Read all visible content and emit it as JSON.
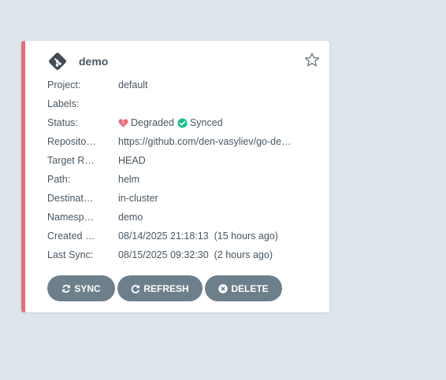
{
  "card": {
    "accent_color": "#e96d76",
    "app_name": "demo",
    "rows": [
      {
        "label": "Project:",
        "value": "default"
      },
      {
        "label": "Labels:",
        "value": ""
      },
      {
        "label": "Status:",
        "health": "Degraded",
        "sync": "Synced"
      },
      {
        "label": "Reposito…",
        "value": "https://github.com/den-vasyliev/go-de…"
      },
      {
        "label": "Target R…",
        "value": "HEAD"
      },
      {
        "label": "Path:",
        "value": "helm"
      },
      {
        "label": "Destinat…",
        "value": "in-cluster"
      },
      {
        "label": "Namesp…",
        "value": "demo"
      },
      {
        "label": "Created …",
        "value": "08/14/2025 21:18:13  (15 hours ago)"
      },
      {
        "label": "Last Sync:",
        "value": "08/15/2025 09:32:30  (2 hours ago)"
      }
    ],
    "buttons": {
      "sync": "SYNC",
      "refresh": "REFRESH",
      "delete": "DELETE"
    },
    "icons": {
      "app": "git-icon",
      "favorite": "star-icon",
      "health": "broken-heart-icon",
      "sync": "check-circle-icon"
    },
    "colors": {
      "degraded": "#e96d76",
      "synced": "#18be94",
      "button": "#6d7f8b"
    }
  }
}
